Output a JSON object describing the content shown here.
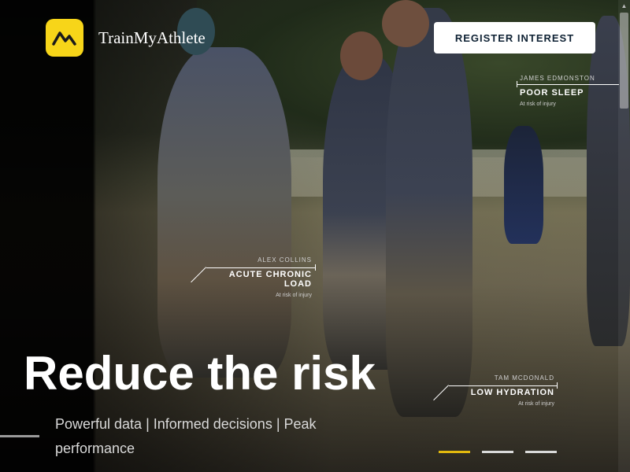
{
  "brand": {
    "name": "TrainMyAthlete",
    "logo_icon": "athlete-chart-icon",
    "logo_color": "#f7d519"
  },
  "header": {
    "cta_label": "REGISTER INTEREST"
  },
  "tags": [
    {
      "athlete": "JAMES EDMONSTON",
      "metric": "POOR SLEEP",
      "status": "At risk of injury"
    },
    {
      "athlete": "ALEX COLLINS",
      "metric": "ACUTE CHRONIC LOAD",
      "status": "At risk of injury"
    },
    {
      "athlete": "TAM MCDONALD",
      "metric": "LOW HYDRATION",
      "status": "At risk of injury"
    }
  ],
  "hero": {
    "headline": "Reduce the risk",
    "tagline": "Powerful data | Informed decisions | Peak performance"
  },
  "slider": {
    "count": 3,
    "active_index": 1,
    "active_color": "#e2b90e"
  },
  "colors": {
    "cta_text": "#0f2234",
    "text": "#ffffff"
  }
}
